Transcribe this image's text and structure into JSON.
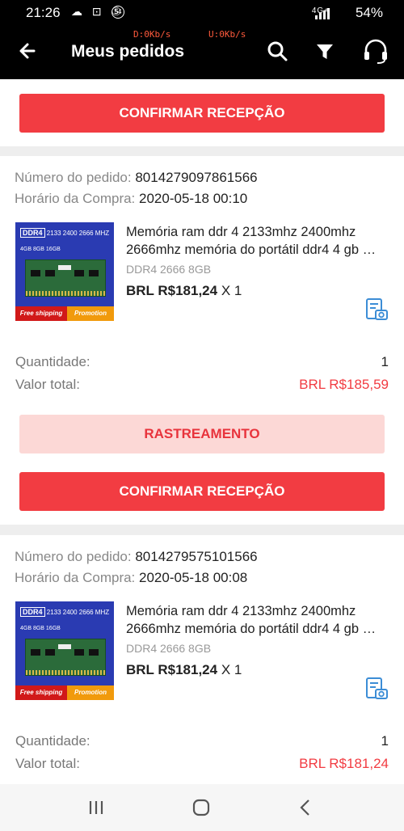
{
  "status_bar": {
    "time": "21:26",
    "notif_icons": "☁ ⊡ ⑤",
    "notif_badge": "54",
    "network": "4G+",
    "battery": "54%"
  },
  "app_bar": {
    "title": "Meus pedidos",
    "download_speed": "D:0Kb/s",
    "upload_speed": "U:0Kb/s"
  },
  "top_card": {
    "confirm_label": "CONFIRMAR RECEPÇÃO"
  },
  "orders": [
    {
      "order_number_label": "Número do pedido:",
      "order_number": "8014279097861566",
      "purchase_time_label": "Horário da Compra:",
      "purchase_time": "2020-05-18 00:10",
      "product": {
        "title_line1": "Memória ram ddr 4 2133mhz 2400mhz",
        "title_line2": "2666mhz memória do portátil ddr4 4 gb …",
        "variant": "DDR4 2666 8GB",
        "price": "BRL R$181,24",
        "qty_suffix": "X 1",
        "thumb": {
          "badge": "DDR4",
          "speeds": "2133 2400 2666 MHZ",
          "sizes": "4GB 8GB 16GB",
          "free": "Free shipping",
          "promo": "Promotion"
        }
      },
      "quantity_label": "Quantidade:",
      "quantity": "1",
      "total_label": "Valor total:",
      "total": "BRL R$185,59",
      "track_label": "RASTREAMENTO",
      "confirm_label": "CONFIRMAR RECEPÇÃO"
    },
    {
      "order_number_label": "Número do pedido:",
      "order_number": "8014279575101566",
      "purchase_time_label": "Horário da Compra:",
      "purchase_time": "2020-05-18 00:08",
      "product": {
        "title_line1": "Memória ram ddr 4 2133mhz 2400mhz",
        "title_line2": "2666mhz memória do portátil ddr4 4 gb …",
        "variant": "DDR4 2666 8GB",
        "price": "BRL R$181,24",
        "qty_suffix": "X 1",
        "thumb": {
          "badge": "DDR4",
          "speeds": "2133 2400 2666 MHZ",
          "sizes": "4GB 8GB 16GB",
          "free": "Free shipping",
          "promo": "Promotion"
        }
      },
      "quantity_label": "Quantidade:",
      "quantity": "1",
      "total_label": "Valor total:",
      "total": "BRL R$181,24"
    }
  ],
  "colors": {
    "accent": "#f23c42",
    "accent_light": "#fcd8d6",
    "icon_blue": "#3c8dd6"
  }
}
